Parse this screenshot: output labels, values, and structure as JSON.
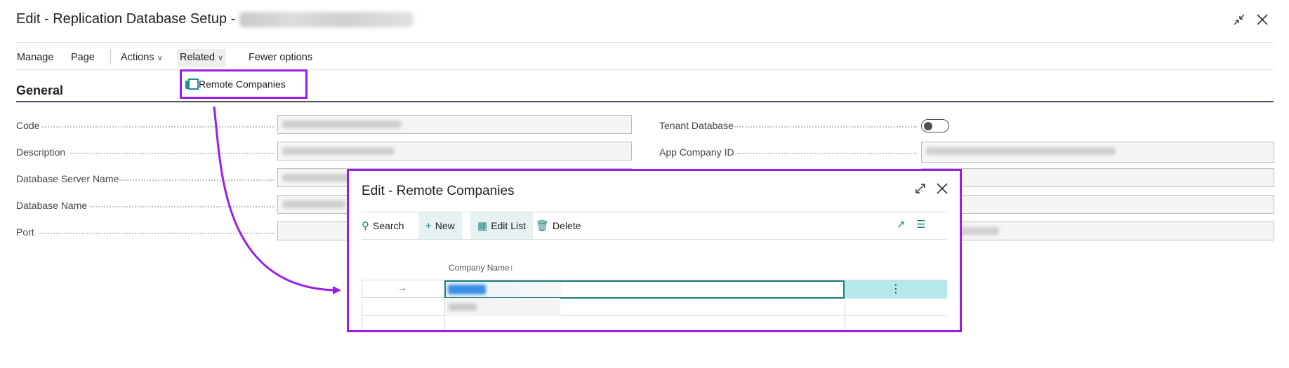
{
  "window": {
    "title": "Edit - Replication Database Setup -",
    "minimize_icon": "collapse-icon",
    "close_icon": "close-icon"
  },
  "menubar": {
    "items": [
      {
        "label": "Manage"
      },
      {
        "label": "Page"
      },
      {
        "label": "Actions"
      },
      {
        "label": "Related"
      },
      {
        "label": "Fewer options"
      }
    ]
  },
  "related_menu": {
    "items": [
      {
        "label": "Remote Companies",
        "icon": "remote-companies-icon"
      }
    ]
  },
  "general": {
    "title": "General",
    "left_fields": [
      {
        "label": "Code"
      },
      {
        "label": "Description"
      },
      {
        "label": "Database Server Name"
      },
      {
        "label": "Database Name"
      },
      {
        "label": "Port"
      }
    ],
    "right_fields": [
      {
        "label": "Tenant Database",
        "toggle": false
      },
      {
        "label": "App Company ID"
      }
    ]
  },
  "remote_companies_dialog": {
    "title": "Edit - Remote Companies",
    "toolbar": {
      "search": "Search",
      "new": "New",
      "edit_list": "Edit List",
      "delete": "Delete"
    },
    "columns": [
      {
        "label": "Company Name",
        "sort": "↑"
      }
    ],
    "row_marker": "→",
    "row_menu": "⋮"
  },
  "colors": {
    "highlight_border": "#9b1de6",
    "accent": "#1d7e7b",
    "selected_cell": "#b5e8ec"
  }
}
